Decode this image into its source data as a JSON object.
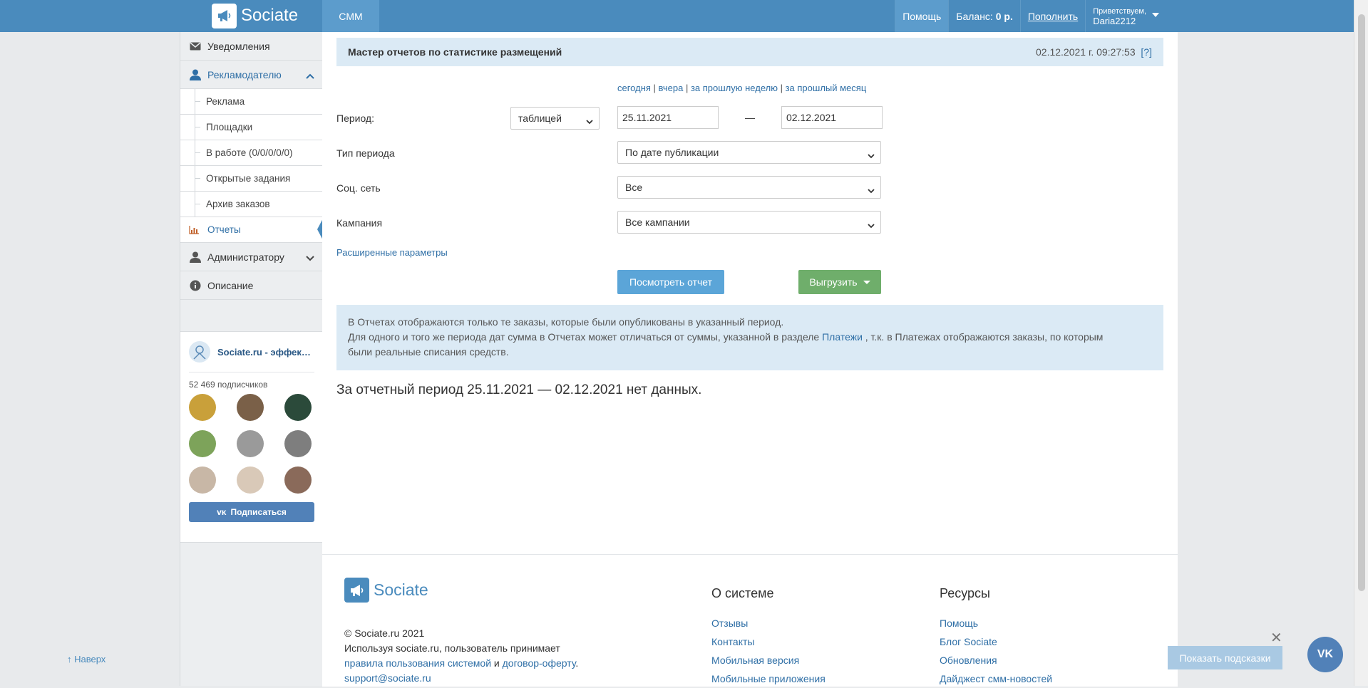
{
  "header": {
    "brand": "Sociate",
    "nav_smm": "CMM",
    "help": "Помощь",
    "balance_label": "Баланс:",
    "balance_value": "0 р.",
    "topup": "Пополнить",
    "greeting": "Приветствуем,",
    "username": "Daria2212"
  },
  "sidebar": {
    "notifications": "Уведомления",
    "advertiser": "Рекламодателю",
    "sub_items": [
      "Реклама",
      "Площадки",
      "В работе (0/0/0/0/0)",
      "Открытые задания",
      "Архив заказов"
    ],
    "reports": "Отчеты",
    "admin": "Администратору",
    "description": "Описание",
    "to_top": "↑ Наверх"
  },
  "vk_widget": {
    "name": "Sociate.ru - эффективная реклама",
    "subscribers": "52 469 подписчиков",
    "subscribe": "Подписаться",
    "avatar_colors": [
      "#c9a03a",
      "#7a6048",
      "#2b4a3a",
      "#7da35a",
      "#9a9a9a",
      "#7e7e7e",
      "#c8b7a6",
      "#d9c9b8",
      "#8a6a5a"
    ]
  },
  "main": {
    "title": "Мастер отчетов по статистике размещений",
    "timestamp": "02.12.2021 г. 09:27:53",
    "help_link": "[?]",
    "quick": [
      "сегодня",
      "вчера",
      "за прошлую неделю",
      "за прошлый месяц"
    ],
    "period_label": "Период:",
    "view_mode": "таблицей",
    "date_from": "25.11.2021",
    "date_dash": "—",
    "date_to": "02.12.2021",
    "period_type_label": "Тип периода",
    "period_type": "По дате публикации",
    "network_label": "Соц. сеть",
    "network": "Все",
    "campaign_label": "Кампания",
    "campaign": "Все кампании",
    "advanced": "Расширенные параметры",
    "view_report": "Посмотреть отчет",
    "export": "Выгрузить",
    "info_line1": "В Отчетах отображаются только те заказы, которые были опубликованы в указанный период.",
    "info_line2_pre": "Для одного и того же периода дат сумма в Отчетах может отличаться от суммы, указанной в разделе ",
    "info_line2_link": "Платежи",
    "info_line2_post": " , т.к. в Платежах отображаются заказы, по которым",
    "info_line3": "были реальные списания средств.",
    "no_data": "За отчетный период 25.11.2021 — 02.12.2021 нет данных."
  },
  "footer": {
    "brand": "Sociate",
    "copyright": "© Sociate.ru 2021",
    "terms_pre": "Используя sociate.ru, пользователь принимает",
    "terms_link1": "правила пользования системой",
    "terms_and": " и ",
    "terms_link2": "договор-оферту",
    "terms_end": ".",
    "support": "support@sociate.ru",
    "about_title": "О системе",
    "about_links": [
      "Отзывы",
      "Контакты",
      "Мобильная версия",
      "Мобильные приложения"
    ],
    "resources_title": "Ресурсы",
    "resources_links": [
      "Помощь",
      "Блог Sociate",
      "Обновления",
      "Дайджест смм-новостей"
    ]
  },
  "hints": {
    "show": "Показать подсказки",
    "close": "✕"
  },
  "vk_float": "VK"
}
